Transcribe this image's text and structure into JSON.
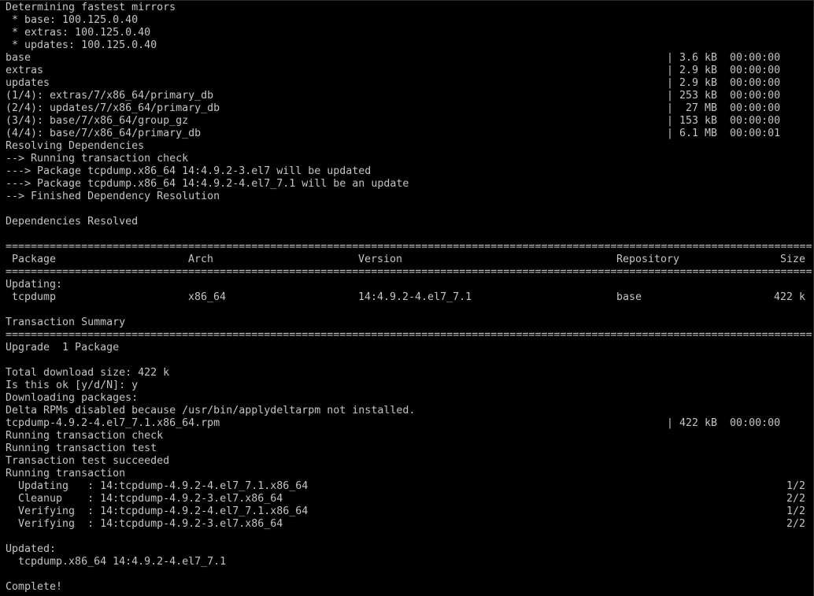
{
  "terminal": {
    "colors": {
      "background": "#000000",
      "foreground": "#c4c4c4"
    },
    "lines": [
      [
        [
          "Determining fastest mirrors",
          0
        ]
      ],
      [
        [
          " * base: 100.125.0.40",
          0
        ]
      ],
      [
        [
          " * extras: 100.125.0.40",
          0
        ]
      ],
      [
        [
          " * updates: 100.125.0.40",
          0
        ]
      ],
      [
        [
          "base",
          0
        ],
        [
          "| 3.6 kB  00:00:00",
          105
        ]
      ],
      [
        [
          "extras",
          0
        ],
        [
          "| 2.9 kB  00:00:00",
          105
        ]
      ],
      [
        [
          "updates",
          0
        ],
        [
          "| 2.9 kB  00:00:00",
          105
        ]
      ],
      [
        [
          "(1/4): extras/7/x86_64/primary_db",
          0
        ],
        [
          "| 253 kB  00:00:00",
          105
        ]
      ],
      [
        [
          "(2/4): updates/7/x86_64/primary_db",
          0
        ],
        [
          "|  27 MB  00:00:00",
          105
        ]
      ],
      [
        [
          "(3/4): base/7/x86_64/group_gz",
          0
        ],
        [
          "| 153 kB  00:00:00",
          105
        ]
      ],
      [
        [
          "(4/4): base/7/x86_64/primary_db",
          0
        ],
        [
          "| 6.1 MB  00:00:01",
          105
        ]
      ],
      [
        [
          "Resolving Dependencies",
          0
        ]
      ],
      [
        [
          "--> Running transaction check",
          0
        ]
      ],
      [
        [
          "---> Package tcpdump.x86_64 14:4.9.2-3.el7 will be updated",
          0
        ]
      ],
      [
        [
          "---> Package tcpdump.x86_64 14:4.9.2-4.el7_7.1 will be an update",
          0
        ]
      ],
      [
        [
          "--> Finished Dependency Resolution",
          0
        ]
      ],
      [],
      [
        [
          "Dependencies Resolved",
          0
        ]
      ],
      [],
      [
        [
          "================================================================================================================================",
          0
        ]
      ],
      [
        [
          " Package",
          0
        ],
        [
          "Arch",
          29
        ],
        [
          "Version",
          56
        ],
        [
          "Repository",
          97
        ],
        [
          "Size",
          123
        ]
      ],
      [
        [
          "================================================================================================================================",
          0
        ]
      ],
      [
        [
          "Updating:",
          0
        ]
      ],
      [
        [
          " tcpdump",
          0
        ],
        [
          "x86_64",
          29
        ],
        [
          "14:4.9.2-4.el7_7.1",
          56
        ],
        [
          "base",
          97
        ],
        [
          "422 k",
          122
        ]
      ],
      [],
      [
        [
          "Transaction Summary",
          0
        ]
      ],
      [
        [
          "================================================================================================================================",
          0
        ]
      ],
      [
        [
          "Upgrade  1 Package",
          0
        ]
      ],
      [],
      [
        [
          "Total download size: 422 k",
          0
        ]
      ],
      [
        [
          "Is this ok [y/d/N]: y",
          0
        ]
      ],
      [
        [
          "Downloading packages:",
          0
        ]
      ],
      [
        [
          "Delta RPMs disabled because /usr/bin/applydeltarpm not installed.",
          0
        ]
      ],
      [
        [
          "tcpdump-4.9.2-4.el7_7.1.x86_64.rpm",
          0
        ],
        [
          "| 422 kB  00:00:00",
          105
        ]
      ],
      [
        [
          "Running transaction check",
          0
        ]
      ],
      [
        [
          "Running transaction test",
          0
        ]
      ],
      [
        [
          "Transaction test succeeded",
          0
        ]
      ],
      [
        [
          "Running transaction",
          0
        ]
      ],
      [
        [
          "  Updating   : 14:tcpdump-4.9.2-4.el7_7.1.x86_64",
          0
        ],
        [
          "1/2",
          124
        ]
      ],
      [
        [
          "  Cleanup    : 14:tcpdump-4.9.2-3.el7.x86_64",
          0
        ],
        [
          "2/2",
          124
        ]
      ],
      [
        [
          "  Verifying  : 14:tcpdump-4.9.2-4.el7_7.1.x86_64",
          0
        ],
        [
          "1/2",
          124
        ]
      ],
      [
        [
          "  Verifying  : 14:tcpdump-4.9.2-3.el7.x86_64",
          0
        ],
        [
          "2/2",
          124
        ]
      ],
      [],
      [
        [
          "Updated:",
          0
        ]
      ],
      [
        [
          "  tcpdump.x86_64 14:4.9.2-4.el7_7.1",
          0
        ]
      ],
      [],
      [
        [
          "Complete!",
          0
        ]
      ]
    ]
  }
}
